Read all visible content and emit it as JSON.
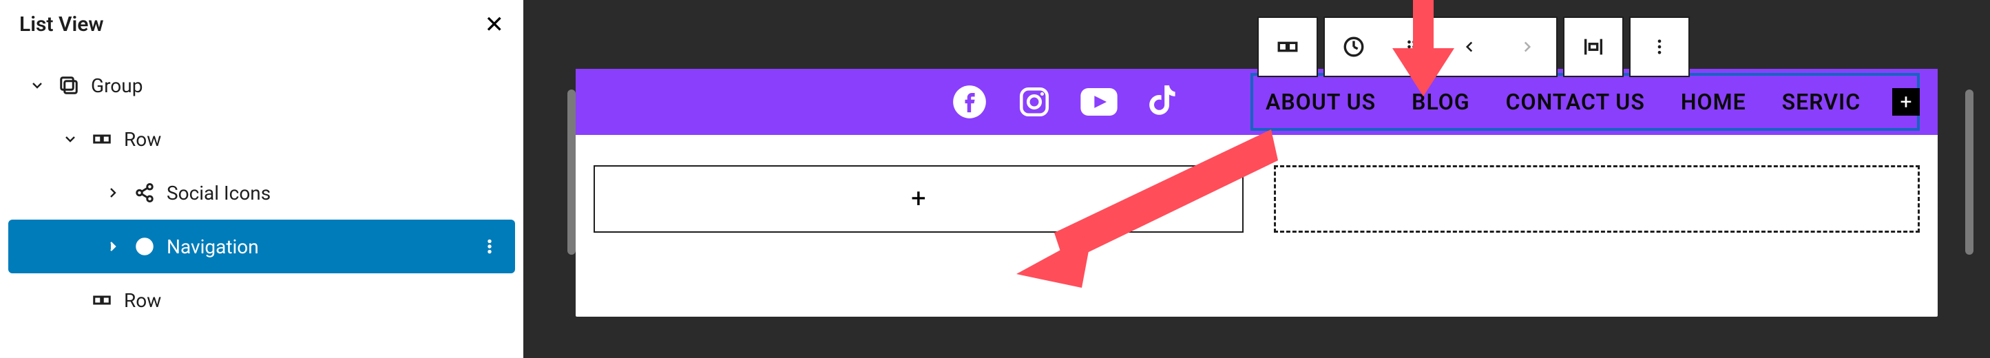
{
  "list_view": {
    "title": "List View",
    "items": [
      {
        "label": "Group",
        "icon": "group",
        "depth": 0,
        "expanded": true
      },
      {
        "label": "Row",
        "icon": "row",
        "depth": 1,
        "expanded": true
      },
      {
        "label": "Social Icons",
        "icon": "share",
        "depth": 2,
        "expanded": false
      },
      {
        "label": "Navigation",
        "icon": "navigation",
        "depth": 2,
        "expanded": false,
        "selected": true
      },
      {
        "label": "Row",
        "icon": "row",
        "depth": 1,
        "expanded": null
      }
    ]
  },
  "toolbar": {
    "buttons": [
      "row-icon",
      "navigation-icon",
      "drag-handle",
      "move-left",
      "move-right",
      "align-icon",
      "more-icon"
    ]
  },
  "header": {
    "socials": [
      "facebook",
      "instagram",
      "youtube",
      "tiktok"
    ],
    "nav_items": [
      "ABOUT US",
      "BLOG",
      "CONTACT US",
      "HOME",
      "SERVIC"
    ]
  },
  "colors": {
    "accent": "#8a3ffc",
    "selection": "#007cba",
    "nav_outline": "#1565c0",
    "arrow": "#ff4d5a"
  }
}
